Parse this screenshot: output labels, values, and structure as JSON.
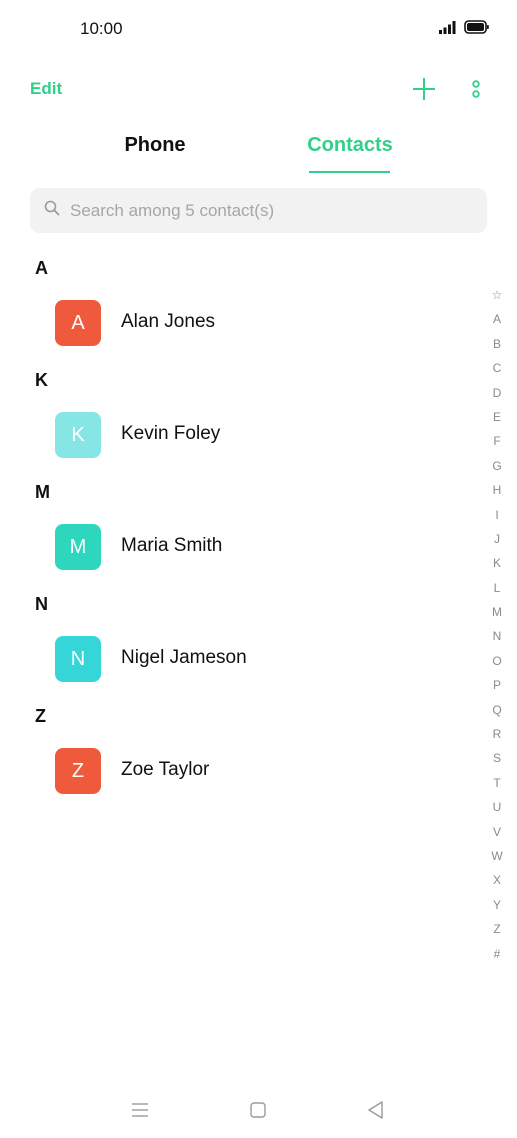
{
  "status_bar": {
    "time": "10:00"
  },
  "toolbar": {
    "edit_label": "Edit"
  },
  "tabs": [
    {
      "label": "Phone",
      "active": false
    },
    {
      "label": "Contacts",
      "active": true
    }
  ],
  "search": {
    "placeholder": "Search among 5 contact(s)",
    "value": ""
  },
  "sections": [
    {
      "letter": "A",
      "contacts": [
        {
          "initial": "A",
          "name": "Alan Jones",
          "color": "#f05a3c"
        }
      ]
    },
    {
      "letter": "K",
      "contacts": [
        {
          "initial": "K",
          "name": "Kevin Foley",
          "color": "#86e6e6"
        }
      ]
    },
    {
      "letter": "M",
      "contacts": [
        {
          "initial": "M",
          "name": "Maria Smith",
          "color": "#2ed6bd"
        }
      ]
    },
    {
      "letter": "N",
      "contacts": [
        {
          "initial": "N",
          "name": "Nigel Jameson",
          "color": "#36d6d8"
        }
      ]
    },
    {
      "letter": "Z",
      "contacts": [
        {
          "initial": "Z",
          "name": "Zoe Taylor",
          "color": "#f05a3c"
        }
      ]
    }
  ],
  "alpha_index": [
    "☆",
    "A",
    "B",
    "C",
    "D",
    "E",
    "F",
    "G",
    "H",
    "I",
    "J",
    "K",
    "L",
    "M",
    "N",
    "O",
    "P",
    "Q",
    "R",
    "S",
    "T",
    "U",
    "V",
    "W",
    "X",
    "Y",
    "Z",
    "#"
  ],
  "colors": {
    "accent": "#2ed08a"
  },
  "icons": {
    "signal": "signal-icon",
    "battery": "battery-icon",
    "add": "plus-icon",
    "more": "more-vertical-icon",
    "search": "search-icon",
    "menu": "menu-icon",
    "home": "home-icon",
    "back": "back-icon"
  }
}
